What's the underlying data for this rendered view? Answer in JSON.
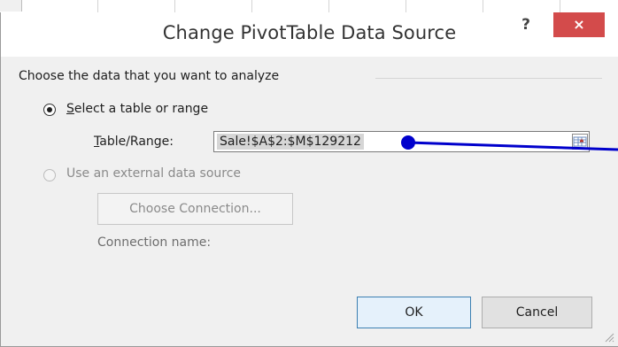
{
  "dialog": {
    "title": "Change PivotTable Data Source",
    "help_label": "?",
    "close_label": "×"
  },
  "group": {
    "label": "Choose the data that you want to analyze"
  },
  "option_table": {
    "accel": "S",
    "label_rest": "elect a table or range",
    "checked": true
  },
  "table_range": {
    "accel": "T",
    "label_rest": "able/Range:",
    "value": "Sale!$A$2:$M$129212"
  },
  "option_external": {
    "label": "Use an external data source",
    "checked": false,
    "disabled": true
  },
  "choose_connection": {
    "label": "Choose Connection...",
    "disabled": true
  },
  "connection_name": {
    "label": "Connection name:"
  },
  "buttons": {
    "ok": "OK",
    "cancel": "Cancel"
  },
  "colors": {
    "close_bg": "#d34b4b",
    "ok_border": "#3c7fb1",
    "annotation": "#0000cc"
  },
  "icons": {
    "collapse": "collapse-dialog-icon",
    "grip": "resize-grip-icon"
  }
}
